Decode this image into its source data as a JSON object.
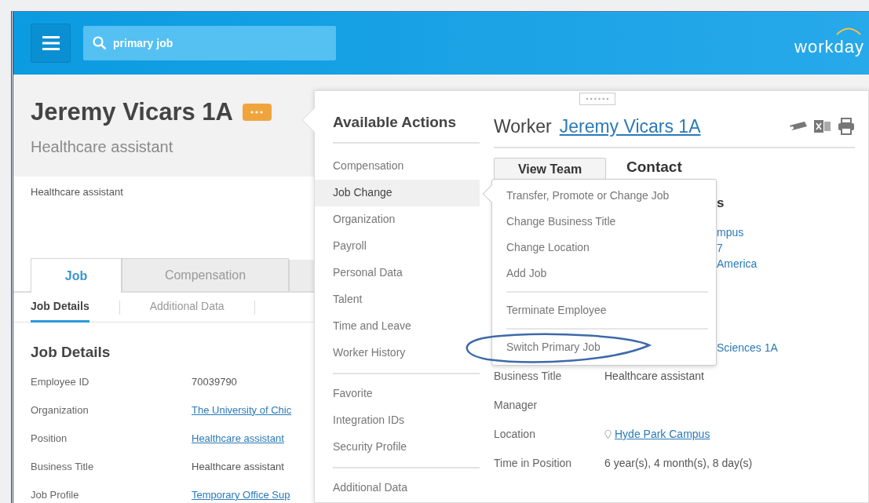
{
  "header": {
    "search": {
      "value": "primary job"
    },
    "logo": "workday"
  },
  "worker": {
    "name": "Jeremy Vicars 1A",
    "title": "Healthcare assistant",
    "summary": "Healthcare assistant"
  },
  "tabs": [
    {
      "label": "Job",
      "selected": true
    },
    {
      "label": "Compensation",
      "selected": false
    }
  ],
  "subtabs": [
    {
      "label": "Job Details",
      "selected": true
    },
    {
      "label": "Additional Data",
      "selected": false
    }
  ],
  "section": {
    "title": "Job Details",
    "fields": [
      {
        "label": "Employee ID",
        "value": "70039790",
        "kind": "text"
      },
      {
        "label": "Organization",
        "value": "The University of Chic",
        "kind": "link"
      },
      {
        "label": "Position",
        "value": "Healthcare assistant",
        "kind": "link"
      },
      {
        "label": "Business Title",
        "value": "Healthcare assistant",
        "kind": "text"
      },
      {
        "label": "Job Profile",
        "value": "Temporary Office Sup",
        "kind": "link"
      }
    ]
  },
  "actions": {
    "title": "Available Actions",
    "groups": [
      [
        {
          "label": "Compensation",
          "selected": false
        },
        {
          "label": "Job Change",
          "selected": true
        },
        {
          "label": "Organization",
          "selected": false
        },
        {
          "label": "Payroll",
          "selected": false
        },
        {
          "label": "Personal Data",
          "selected": false
        },
        {
          "label": "Talent",
          "selected": false
        },
        {
          "label": "Time and Leave",
          "selected": false
        },
        {
          "label": "Worker History",
          "selected": false
        }
      ],
      [
        {
          "label": "Favorite",
          "selected": false
        },
        {
          "label": "Integration IDs",
          "selected": false
        },
        {
          "label": "Security Profile",
          "selected": false
        }
      ],
      [
        {
          "label": "Additional Data",
          "selected": false
        }
      ]
    ]
  },
  "worker_card": {
    "label": "Worker",
    "name": "Jeremy Vicars 1A",
    "view_team": "View Team",
    "contact": "Contact",
    "fragments": [
      {
        "text": "s",
        "kind": "heading"
      },
      {
        "text": "mpus",
        "kind": "link"
      },
      {
        "text": "7",
        "kind": "link"
      },
      {
        "text": "America",
        "kind": "link"
      },
      {
        "text": "Sciences 1A",
        "kind": "link"
      }
    ],
    "fields": [
      {
        "label": "Business Title",
        "value": "Healthcare assistant",
        "kind": "text"
      },
      {
        "label": "Manager"
      },
      {
        "label": "Location",
        "value": "Hyde Park Campus",
        "kind": "location"
      },
      {
        "label": "Time in Position",
        "value": "6 year(s), 4 month(s), 8 day(s)",
        "kind": "text"
      }
    ]
  },
  "submenu": {
    "groups": [
      [
        {
          "label": "Transfer, Promote or Change Job",
          "circled": false
        },
        {
          "label": "Change Business Title",
          "circled": false
        },
        {
          "label": "Change Location",
          "circled": false
        },
        {
          "label": "Add Job",
          "circled": false
        }
      ],
      [
        {
          "label": "Terminate Employee",
          "circled": false
        }
      ],
      [
        {
          "label": "Switch Primary Job",
          "circled": true
        }
      ]
    ]
  }
}
